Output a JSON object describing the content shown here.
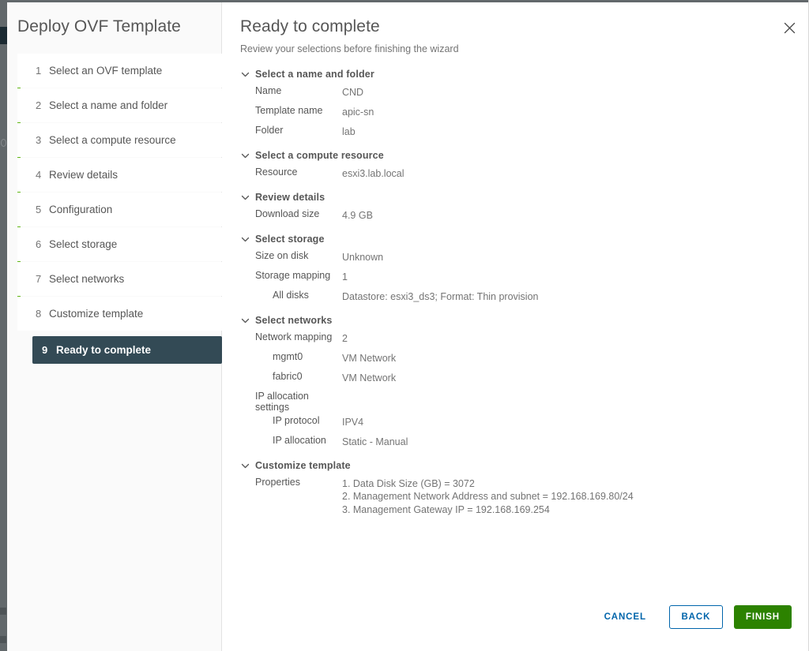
{
  "wizard": {
    "title": "Deploy OVF Template",
    "accent_color": "#60b515",
    "active_color": "#334a55",
    "steps": [
      {
        "num": "1",
        "label": "Select an OVF template",
        "active": false
      },
      {
        "num": "2",
        "label": "Select a name and folder",
        "active": false
      },
      {
        "num": "3",
        "label": "Select a compute resource",
        "active": false
      },
      {
        "num": "4",
        "label": "Review details",
        "active": false
      },
      {
        "num": "5",
        "label": "Configuration",
        "active": false
      },
      {
        "num": "6",
        "label": "Select storage",
        "active": false
      },
      {
        "num": "7",
        "label": "Select networks",
        "active": false
      },
      {
        "num": "8",
        "label": "Customize template",
        "active": false
      },
      {
        "num": "9",
        "label": "Ready to complete",
        "active": true
      }
    ]
  },
  "header": {
    "title": "Ready to complete",
    "subtitle": "Review your selections before finishing the wizard",
    "close_icon": "close-icon"
  },
  "summary": {
    "sections": [
      {
        "title": "Select a name and folder",
        "chevron_icon": "chevron-down-icon",
        "rows": [
          {
            "label": "Name",
            "value": "CND",
            "indent": false
          },
          {
            "label": "Template name",
            "value": "apic-sn",
            "indent": false
          },
          {
            "label": "Folder",
            "value": "lab",
            "indent": false
          }
        ]
      },
      {
        "title": "Select a compute resource",
        "chevron_icon": "chevron-down-icon",
        "rows": [
          {
            "label": "Resource",
            "value": "esxi3.lab.local",
            "indent": false
          }
        ]
      },
      {
        "title": "Review details",
        "chevron_icon": "chevron-down-icon",
        "rows": [
          {
            "label": "Download size",
            "value": "4.9 GB",
            "indent": false
          }
        ]
      },
      {
        "title": "Select storage",
        "chevron_icon": "chevron-down-icon",
        "rows": [
          {
            "label": "Size on disk",
            "value": "Unknown",
            "indent": false
          },
          {
            "label": "Storage mapping",
            "value": "1",
            "indent": false
          },
          {
            "label": "All disks",
            "value": "Datastore: esxi3_ds3; Format: Thin provision",
            "indent": true
          }
        ]
      },
      {
        "title": "Select networks",
        "chevron_icon": "chevron-down-icon",
        "rows": [
          {
            "label": "Network mapping",
            "value": "2",
            "indent": false
          },
          {
            "label": "mgmt0",
            "value": "VM Network",
            "indent": true
          },
          {
            "label": "fabric0",
            "value": "VM Network",
            "indent": true
          },
          {
            "label": "IP allocation settings",
            "value": "",
            "indent": false
          },
          {
            "label": "IP protocol",
            "value": "IPV4",
            "indent": true
          },
          {
            "label": "IP allocation",
            "value": "Static - Manual",
            "indent": true
          }
        ]
      },
      {
        "title": "Customize template",
        "chevron_icon": "chevron-down-icon",
        "rows": [
          {
            "label": "Properties",
            "value": "1. Data Disk Size (GB) = 3072\n2. Management Network Address and subnet = 192.168.169.80/24\n3. Management Gateway IP = 192.168.169.254",
            "indent": false
          }
        ]
      }
    ]
  },
  "footer": {
    "cancel_label": "CANCEL",
    "back_label": "BACK",
    "finish_label": "FINISH",
    "link_color": "#0065ab",
    "finish_color": "#2c8200"
  }
}
